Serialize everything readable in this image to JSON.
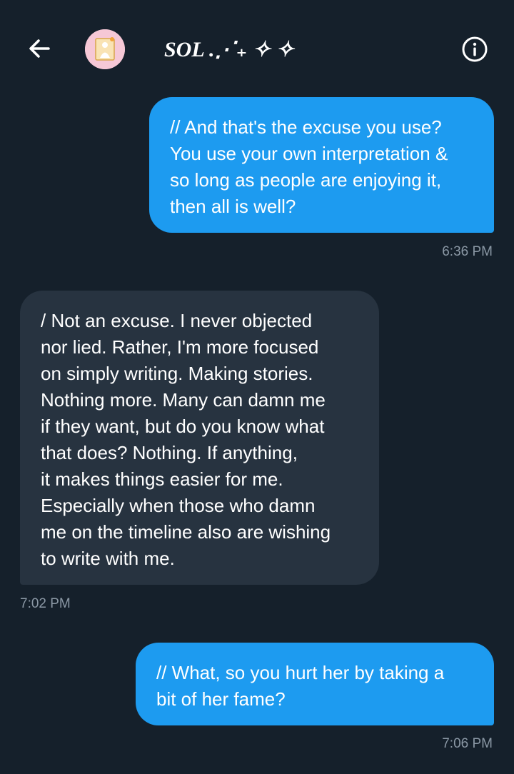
{
  "header": {
    "title": "SOL .⋰₊ ✧ ✧",
    "back_icon": "arrow-left-icon",
    "info_icon": "info-circle-icon",
    "avatar_bg": "#f6c8d6"
  },
  "messages": [
    {
      "direction": "sent",
      "lines": [
        "// And that's the excuse you use?",
        "You use your own interpretation &",
        "so long as people are enjoying it,",
        "then all is well?"
      ],
      "time": "6:36 PM"
    },
    {
      "direction": "received",
      "lines": [
        "/ Not an excuse. I never objected",
        "nor lied. Rather, I'm more focused",
        "on simply writing. Making stories.",
        "Nothing more. Many can damn me",
        "if they want, but do you know what",
        "that does? Nothing. If anything,",
        "it makes things easier for me.",
        "Especially when those who damn",
        "me on the timeline also are wishing",
        "to write with me."
      ],
      "time": "7:02 PM"
    },
    {
      "direction": "sent",
      "lines": [
        "// What, so you hurt her by taking a",
        "bit of her fame?"
      ],
      "time": "7:06 PM"
    }
  ],
  "colors": {
    "background": "#15202b",
    "sent_bubble": "#1d9bf0",
    "received_bubble": "#273340",
    "timestamp": "#8b98a5"
  }
}
